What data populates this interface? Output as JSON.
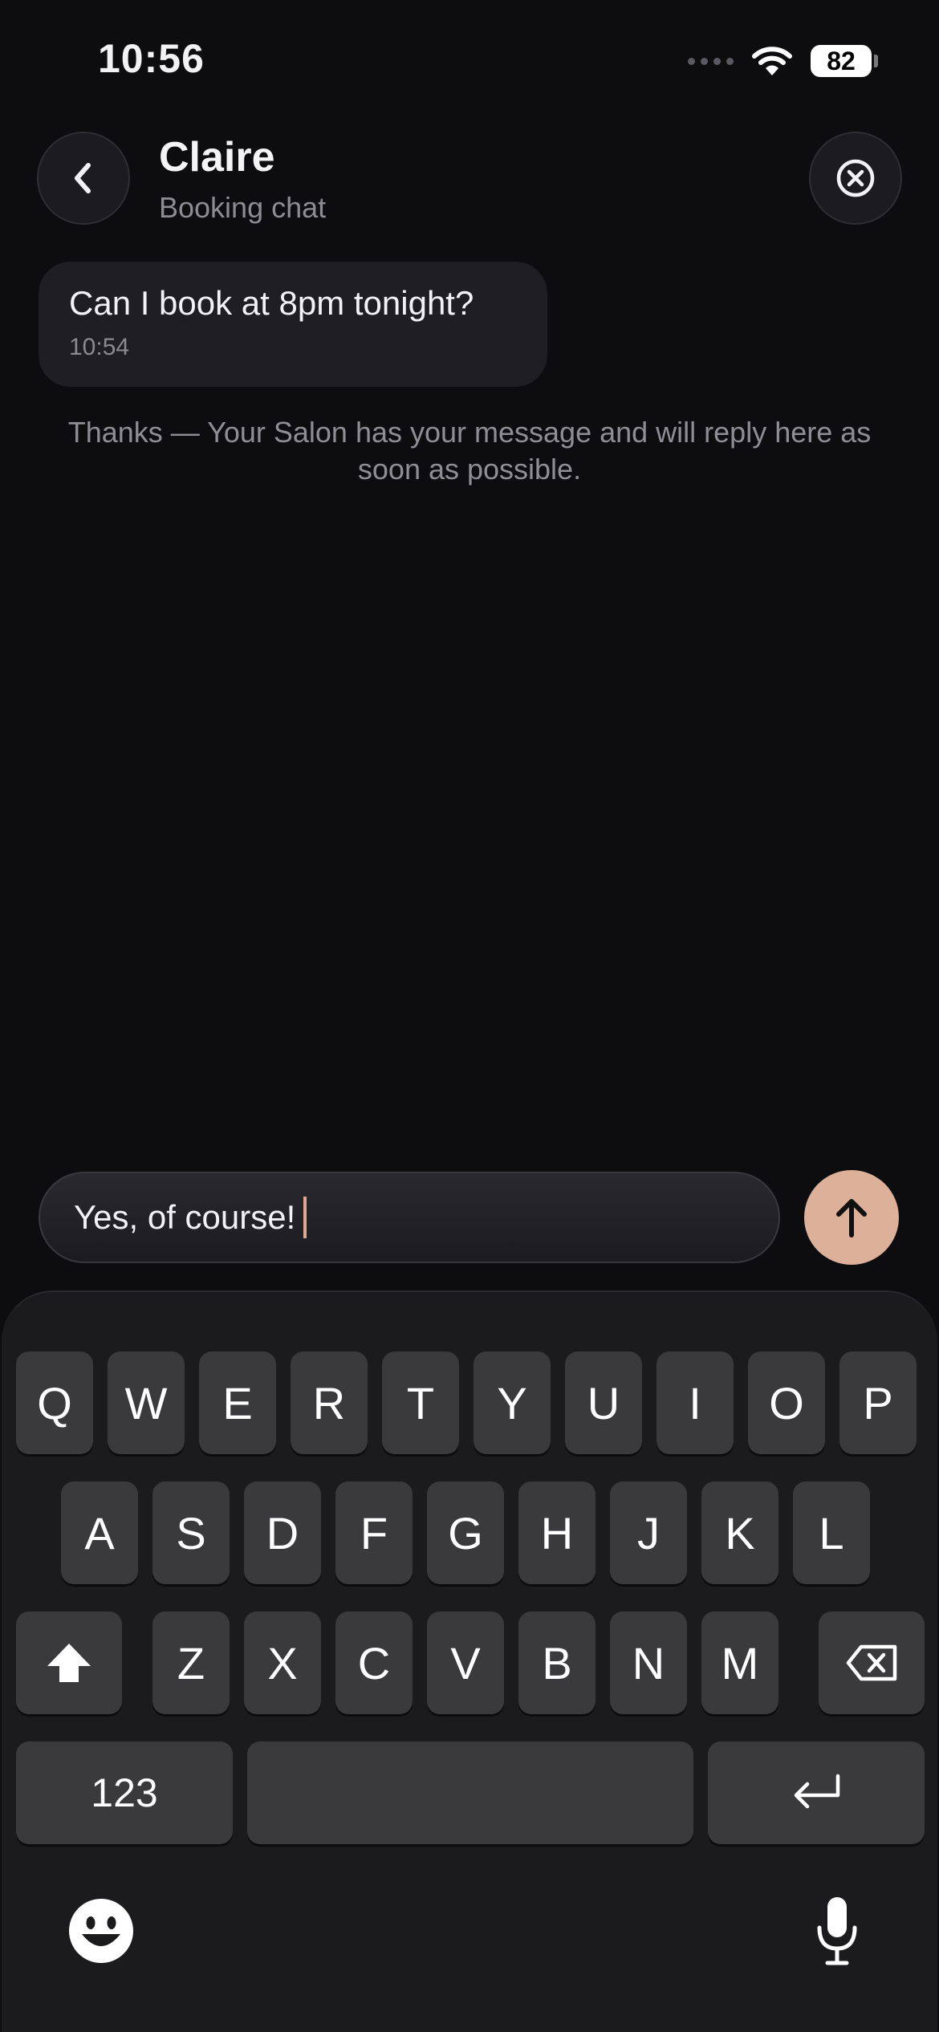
{
  "status_bar": {
    "time": "10:56",
    "battery": "82",
    "signal_icon": "signal-dots-icon",
    "wifi_icon": "wifi-icon"
  },
  "header": {
    "title": "Claire",
    "subtitle": "Booking chat",
    "back_icon": "chevron-left-icon",
    "close_icon": "close-circle-icon"
  },
  "messages": [
    {
      "text": "Can I book at 8pm tonight?",
      "time": "10:54"
    }
  ],
  "system_note": "Thanks — Your Salon has your message and will reply here as soon as possible.",
  "composer": {
    "value": "Yes, of course!",
    "send_icon": "arrow-up-icon",
    "accent": "#ddb09a"
  },
  "keyboard": {
    "row1": [
      "Q",
      "W",
      "E",
      "R",
      "T",
      "Y",
      "U",
      "I",
      "O",
      "P"
    ],
    "row2": [
      "A",
      "S",
      "D",
      "F",
      "G",
      "H",
      "J",
      "K",
      "L"
    ],
    "row3": [
      "Z",
      "X",
      "C",
      "V",
      "B",
      "N",
      "M"
    ],
    "numbers_label": "123",
    "icons": {
      "shift": "shift-icon",
      "backspace": "backspace-icon",
      "return": "return-icon",
      "emoji": "emoji-icon",
      "mic": "microphone-icon"
    }
  }
}
